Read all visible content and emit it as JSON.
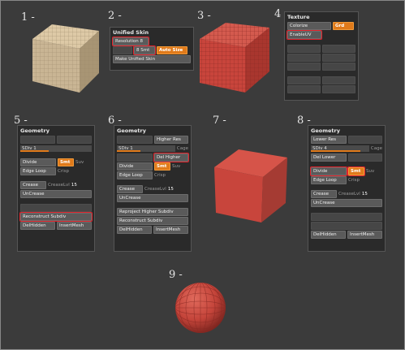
{
  "step_numbers": [
    "1 -",
    "2 -",
    "3 -",
    "4 -",
    "5 -",
    "6 -",
    "7 -",
    "8 -",
    "9 -"
  ],
  "colors": {
    "background": "#3b3b3b",
    "accent_orange": "#e07a1a",
    "highlight_red": "#e0222a",
    "cube_tan": "#c9b594",
    "cube_red": "#c8453c"
  },
  "unified_skin": {
    "title": "Unified Skin",
    "resolution_label": "Resolution",
    "resolution_value": "8",
    "smooth_value": "8",
    "smt_label": "Smt",
    "auto_size_label": "Auto Size",
    "make_label": "Make Unified Skin"
  },
  "texture": {
    "title": "Texture",
    "colorize_label": "Colorize",
    "grd_label": "Grd",
    "enable_uv_label": "EnableUV"
  },
  "geometry_5": {
    "title": "Geometry",
    "sdiv_label": "SDiv",
    "sdiv_value": "1",
    "divide_label": "Divide",
    "smt_label": "Smt",
    "suv_label": "Suv",
    "edge_loop_label": "Edge Loop",
    "crisp_label": "Crisp",
    "crease_label": "Crease",
    "creaselvl_label": "CreaseLvl",
    "creaselvl_value": "15",
    "uncrease_label": "UnCrease",
    "reconstruct_label": "Reconstruct Subdiv",
    "delhidden_label": "DelHidden",
    "insertmesh_label": "InsertMesh"
  },
  "geometry_6": {
    "title": "Geometry",
    "higher_res_label": "Higher Res",
    "sdiv_label": "SDiv",
    "sdiv_value": "1",
    "cage_label": "Cage",
    "del_higher_label": "Del Higher",
    "divide_label": "Divide",
    "smt_label": "Smt",
    "suv_label": "Suv",
    "edge_loop_label": "Edge Loop",
    "crisp_label": "Crisp",
    "crease_label": "Crease",
    "creaselvl_label": "CreaseLvl",
    "creaselvl_value": "15",
    "uncrease_label": "UnCrease",
    "reproject_label": "Reproject Higher Subdiv",
    "reconstruct_label": "Reconstruct Subdiv",
    "delhidden_label": "DelHidden",
    "insertmesh_label": "InsertMesh"
  },
  "geometry_8": {
    "title": "Geometry",
    "lower_res_label": "Lower Res",
    "sdiv_label": "SDiv",
    "sdiv_value": "4",
    "cage_label": "Cage",
    "del_lower_label": "Del Lower",
    "divide_label": "Divide",
    "smt_label": "Smt",
    "suv_label": "Suv",
    "edge_loop_label": "Edge Loop",
    "crisp_label": "Crisp",
    "crease_label": "Crease",
    "creaselvl_label": "CreaseLvl",
    "creaselvl_value": "15",
    "uncrease_label": "UnCrease",
    "delhidden_label": "DelHidden",
    "insertmesh_label": "InsertMesh"
  }
}
